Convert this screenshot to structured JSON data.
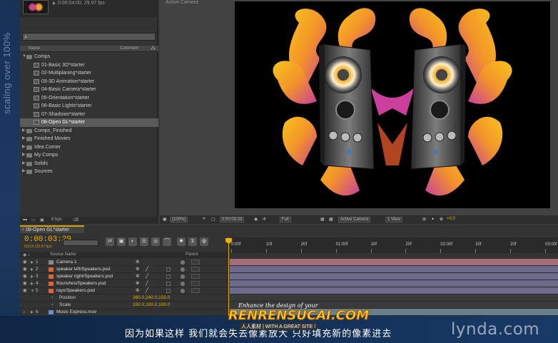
{
  "side_text": "scaling over 100%",
  "project": {
    "info": "▲ 0:00:04:00, 29.97 fps",
    "columns": {
      "name": "Name",
      "comment": "Comment"
    },
    "items": [
      {
        "type": "folder",
        "label": "Comps",
        "open": true
      },
      {
        "type": "comp",
        "label": "01-Basic 3D*starter"
      },
      {
        "type": "comp",
        "label": "02-Multiplaning*starter"
      },
      {
        "type": "comp",
        "label": "03-3D Animation*starter"
      },
      {
        "type": "comp",
        "label": "04-Basic Camera*starter"
      },
      {
        "type": "comp",
        "label": "05-Orientation*starter"
      },
      {
        "type": "comp",
        "label": "06-Basic Lights*starter"
      },
      {
        "type": "comp",
        "label": "07-Shadows*starter"
      },
      {
        "type": "comp",
        "label": "08-Open GL*starter",
        "selected": true
      },
      {
        "type": "folder",
        "label": "Comps_Finished"
      },
      {
        "type": "folder",
        "label": "Finished Movies"
      },
      {
        "type": "folder",
        "label": "Idea Corner"
      },
      {
        "type": "folder",
        "label": "My Comps"
      },
      {
        "type": "folder",
        "label": "Solids"
      },
      {
        "type": "folder",
        "label": "Sources"
      }
    ],
    "footer_bpc": "8 bpc"
  },
  "viewer": {
    "title": "Active Camera",
    "zoom": "(100%)",
    "timecode": "0:00:03:29",
    "resolution": "Full",
    "camera": "Active Camera",
    "views": "1 View",
    "exposure": "+0.0"
  },
  "timeline": {
    "tab": "08-Open GL*starter",
    "timecode": "0:00:03:29",
    "timecode_sub": "00119 (29.97 fps)",
    "header": {
      "source": "Source Name",
      "parent": "Parent"
    },
    "layers": [
      {
        "num": "1",
        "name": "Camera 1"
      },
      {
        "num": "2",
        "name": "speaker left/Speakers.psd"
      },
      {
        "num": "3",
        "name": "speaker right/Speakers.psd"
      },
      {
        "num": "4",
        "name": "flourishes/Speakers.psd"
      },
      {
        "num": "5",
        "name": "rays/Speakers.psd"
      }
    ],
    "props": [
      {
        "name": "Position",
        "value": "360.0,240.0,150.0"
      },
      {
        "name": "Scale",
        "value": "100.0,100.0,100.0"
      }
    ],
    "layer6": {
      "num": "6",
      "name": "Music Express.mov"
    },
    "ruler": [
      "0:00f",
      "10f",
      "20f",
      "01:00f",
      "10f",
      "20f",
      "02:00f",
      "10f",
      "20f",
      "03:00f"
    ]
  },
  "subtitle": "因为如果这样 我们就会失去像素放大 只好填充新的像素进去",
  "brand": "lynda.com",
  "watermark": {
    "top": "Enhance the design of your",
    "main": "RENRENSUCAI.COM",
    "sub": "人人素材 | WITH A GREAT SITE !"
  },
  "colors": {
    "accent": "#e7b300",
    "speaker_magenta": "#c93f9b",
    "speaker_orange": "#f2a02e"
  }
}
